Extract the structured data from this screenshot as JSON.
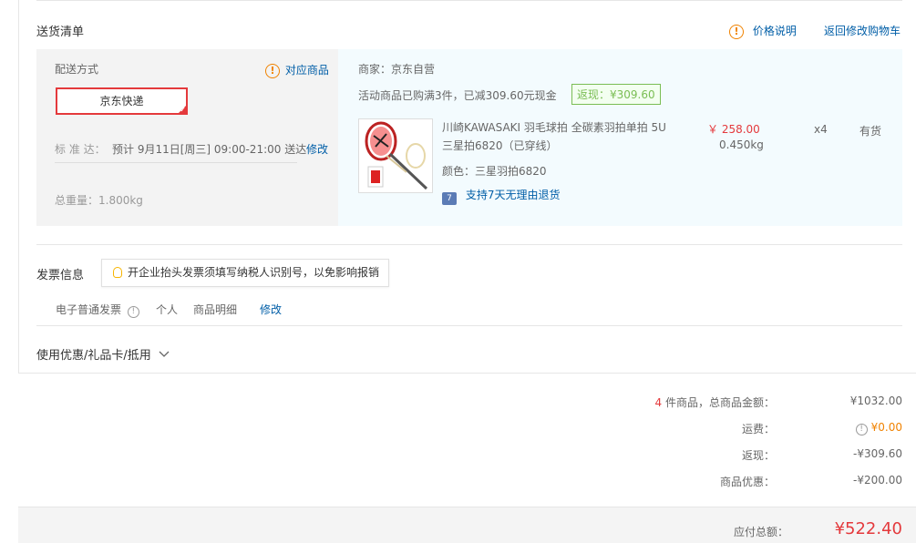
{
  "delivery": {
    "title": "送货清单",
    "price_info_label": "价格说明",
    "back_to_cart_label": "返回修改购物车",
    "method_label": "配送方式",
    "related_goods_label": "对应商品",
    "express_label": "京东快递",
    "standard_label": "标 准 达：",
    "standard_time": "预计 9月11日[周三] 09:00-21:00 送达",
    "modify_label": "修改",
    "total_weight": "总重量：1.800kg"
  },
  "seller": {
    "label": "商家：京东自营",
    "promo_text": "活动商品已购满3件，已减309.60元现金",
    "rebate_tag": "返现：¥309.60"
  },
  "product": {
    "title_line1": "川崎KAWASAKI 羽毛球拍 全碳素羽拍单拍 5U",
    "title_line2": "三星拍6820（已穿线）",
    "color": "颜色：三星羽拍6820",
    "return_policy": "支持7天无理由退货",
    "price": "￥ 258.00",
    "weight": "0.450kg",
    "qty": "x4",
    "stock": "有货"
  },
  "invoice": {
    "title": "发票信息",
    "tip": "开企业抬头发票须填写纳税人识别号，以免影响报销",
    "type": "电子普通发票",
    "owner": "个人",
    "content": "商品明细",
    "modify_label": "修改"
  },
  "coupon": {
    "label": "使用优惠/礼品卡/抵用"
  },
  "summary": {
    "count": "4",
    "goods_label": "件商品，总商品金额：",
    "goods_value": "¥1032.00",
    "freight_label": "运费：",
    "freight_value": "¥0.00",
    "rebate_label": "返现：",
    "rebate_value": "-¥309.60",
    "discount_label": "商品优惠：",
    "discount_value": "-¥200.00",
    "payable_label": "应付总额：",
    "payable_value": "¥522.40"
  },
  "colors": {
    "accent_red": "#e4393c",
    "link_blue": "#005ea7",
    "rebate_green": "#7abd54",
    "warn_orange": "#f08200"
  }
}
